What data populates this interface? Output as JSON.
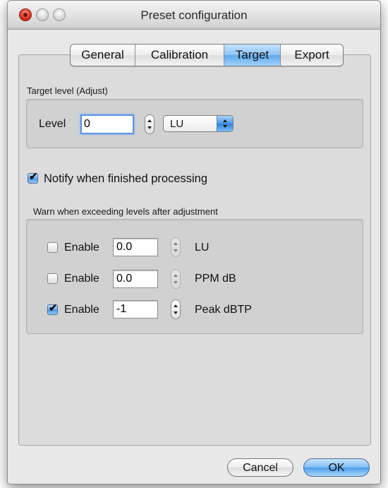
{
  "window": {
    "title": "Preset configuration"
  },
  "tabs": [
    {
      "label": "General",
      "active": false
    },
    {
      "label": "Calibration",
      "active": false
    },
    {
      "label": "Target",
      "active": true
    },
    {
      "label": "Export",
      "active": false
    }
  ],
  "target_level": {
    "group_label": "Target level (Adjust)",
    "level_label": "Level",
    "level_value": "0",
    "unit_value": "LU"
  },
  "notify": {
    "label": "Notify when finished processing",
    "checked": true
  },
  "warn": {
    "group_label": "Warn when exceeding levels after adjustment",
    "rows": [
      {
        "enable_label": "Enable",
        "checked": false,
        "value": "0.0",
        "unit": "LU"
      },
      {
        "enable_label": "Enable",
        "checked": false,
        "value": "0.0",
        "unit": "PPM dB"
      },
      {
        "enable_label": "Enable",
        "checked": true,
        "value": "-1",
        "unit": "Peak dBTP"
      }
    ]
  },
  "buttons": {
    "cancel_label": "Cancel",
    "ok_label": "OK"
  },
  "colors": {
    "accent": "#5ea8ec",
    "close": "#d8301c"
  },
  "icons": [
    "close-window-icon",
    "minimize-window-icon",
    "zoom-window-icon",
    "checkmark-icon",
    "stepper-arrows-icon",
    "popup-arrows-icon"
  ]
}
